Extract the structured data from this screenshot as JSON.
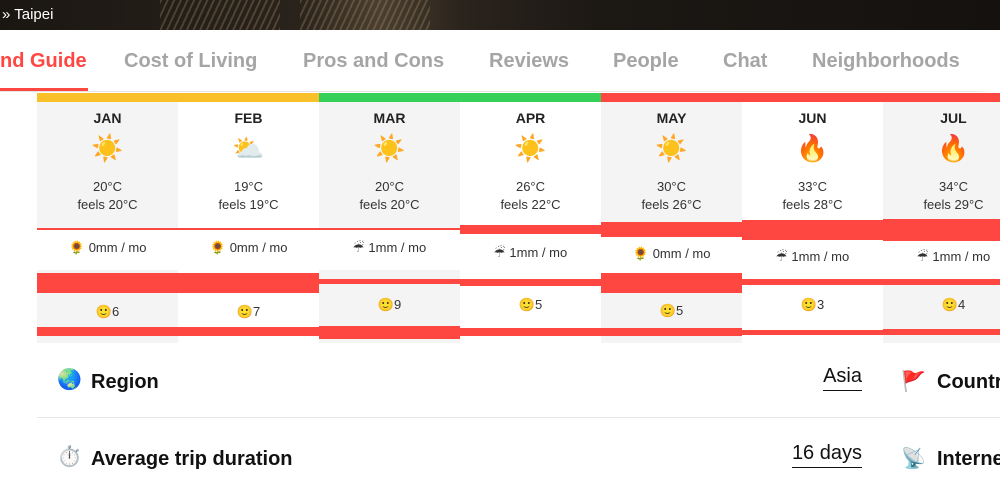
{
  "breadcrumb": "» Taipei",
  "tabs": [
    {
      "label": "nd Guide",
      "active": true
    },
    {
      "label": "Cost of Living"
    },
    {
      "label": "Pros and Cons"
    },
    {
      "label": "Reviews"
    },
    {
      "label": "People"
    },
    {
      "label": "Chat"
    },
    {
      "label": "Neighborhoods"
    }
  ],
  "colors": {
    "accent": "#ff4742",
    "yellow": "#f9c02a",
    "green": "#34d058",
    "gray": "#a5a5a5"
  },
  "months": [
    {
      "name": "JAN",
      "icon": "☀️",
      "temp": "20°C",
      "feels": "feels 20°C",
      "rain_icon": "🌻",
      "rain": "0mm / mo",
      "happy_icon": "🙂",
      "happy": "6"
    },
    {
      "name": "FEB",
      "icon": "⛅",
      "temp": "19°C",
      "feels": "feels 19°C",
      "rain_icon": "🌻",
      "rain": "0mm / mo",
      "happy_icon": "🙂",
      "happy": "7"
    },
    {
      "name": "MAR",
      "icon": "☀️",
      "temp": "20°C",
      "feels": "feels 20°C",
      "rain_icon": "☔",
      "rain": "1mm / mo",
      "happy_icon": "🙂",
      "happy": "9"
    },
    {
      "name": "APR",
      "icon": "☀️",
      "temp": "26°C",
      "feels": "feels 22°C",
      "rain_icon": "☔",
      "rain": "1mm / mo",
      "happy_icon": "🙂",
      "happy": "5"
    },
    {
      "name": "MAY",
      "icon": "☀️",
      "temp": "30°C",
      "feels": "feels 26°C",
      "rain_icon": "🌻",
      "rain": "0mm / mo",
      "happy_icon": "🙂",
      "happy": "5"
    },
    {
      "name": "JUN",
      "icon": "🔥",
      "temp": "33°C",
      "feels": "feels 28°C",
      "rain_icon": "☔",
      "rain": "1mm / mo",
      "happy_icon": "🙂",
      "happy": "3"
    },
    {
      "name": "JUL",
      "icon": "🔥",
      "temp": "34°C",
      "feels": "feels 29°C",
      "rain_icon": "☔",
      "rain": "1mm / mo",
      "happy_icon": "🙂",
      "happy": "4"
    }
  ],
  "rows": [
    {
      "icon": "🌏",
      "label": "Region",
      "value": "Asia",
      "icon2": "🚩",
      "label2": "Countr"
    },
    {
      "icon": "⏱️",
      "label": "Average trip duration",
      "value": "16 days",
      "icon2": "📡",
      "label2": "Interne"
    }
  ]
}
